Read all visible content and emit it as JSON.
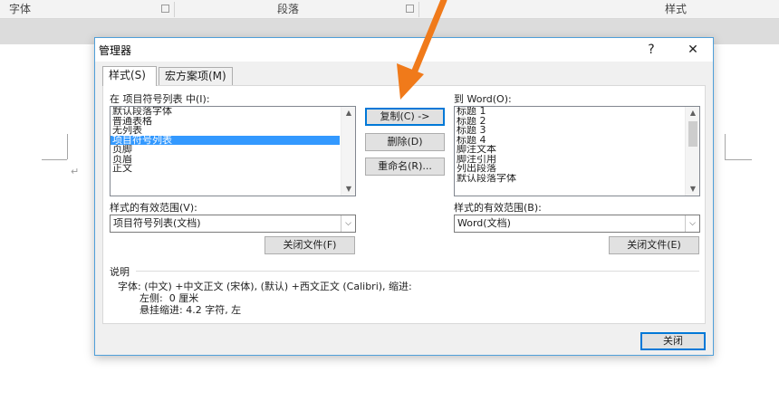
{
  "ribbon": {
    "font_group": "字体",
    "paragraph_group": "段落",
    "styles_group": "样式"
  },
  "document": {
    "paragraph_mark": "↵"
  },
  "dialog": {
    "title": "管理器",
    "help_label": "?",
    "close_label": "✕",
    "tabs": [
      {
        "label": "样式(S)"
      },
      {
        "label": "宏方案项(M)"
      }
    ],
    "left": {
      "list_label": "在 项目符号列表 中(I):",
      "items": [
        "默认段落字体",
        "普通表格",
        "无列表",
        "项目符号列表",
        "页脚",
        "页眉",
        "正文"
      ],
      "selected_index": 3,
      "scope_label": "样式的有效范围(V):",
      "scope_value": "项目符号列表(文档)",
      "close_file_button": "关闭文件(F)"
    },
    "right": {
      "list_label": "到 Word(O):",
      "items": [
        "标题 1",
        "标题 2",
        "标题 3",
        "标题 4",
        "脚注文本",
        "脚注引用",
        "列出段落",
        "默认段落字体"
      ],
      "scope_label": "样式的有效范围(B):",
      "scope_value": "Word(文档)",
      "close_file_button": "关闭文件(E)"
    },
    "buttons": {
      "copy": "复制(C) ->",
      "delete": "删除(D)",
      "rename": "重命名(R)..."
    },
    "description": {
      "heading": "说明",
      "line1": "字体: (中文) +中文正文 (宋体), (默认) +西文正文 (Calibri), 缩进:",
      "line2": "左侧:  0 厘米",
      "line3": "悬挂缩进: 4.2 字符, 左"
    },
    "close_button": "关闭"
  },
  "colors": {
    "selection": "#3399ff",
    "dialog_border": "#4f9fd9",
    "arrow": "#f07a1a"
  },
  "icons": {
    "scroll_up": "▲",
    "scroll_down": "▼",
    "combo_arrow": "⌵"
  }
}
